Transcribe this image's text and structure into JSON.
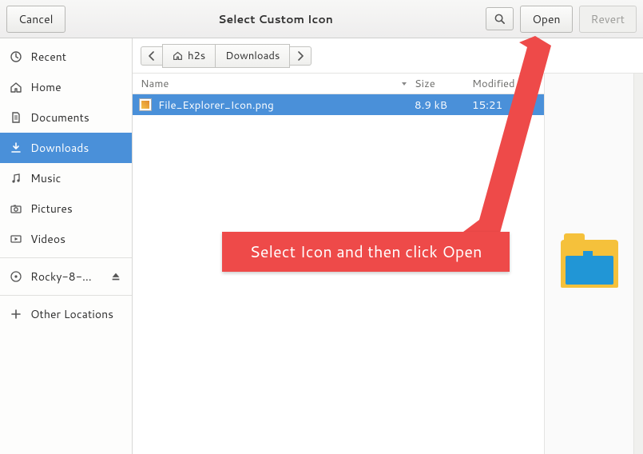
{
  "header": {
    "cancel": "Cancel",
    "title": "Select Custom Icon",
    "open": "Open",
    "revert": "Revert"
  },
  "sidebar": {
    "items": [
      {
        "icon": "clock",
        "label": "Recent"
      },
      {
        "icon": "home",
        "label": "Home"
      },
      {
        "icon": "doc",
        "label": "Documents"
      },
      {
        "icon": "download",
        "label": "Downloads",
        "selected": true
      },
      {
        "icon": "music",
        "label": "Music"
      },
      {
        "icon": "camera",
        "label": "Pictures"
      },
      {
        "icon": "video",
        "label": "Videos"
      }
    ],
    "volumes": [
      {
        "icon": "disc",
        "label": "Rocky-8-…",
        "eject": true
      }
    ],
    "other": {
      "icon": "plus",
      "label": "Other Locations"
    }
  },
  "path": {
    "segments": [
      {
        "icon": "chevron-left"
      },
      {
        "icon": "home",
        "label": "h2s"
      },
      {
        "label": "Downloads"
      },
      {
        "icon": "chevron-right"
      }
    ]
  },
  "columns": {
    "name": "Name",
    "size": "Size",
    "modified": "Modified"
  },
  "files": [
    {
      "name": "File_Explorer_Icon.png",
      "size": "8.9 kB",
      "modified": "15:21",
      "selected": true
    }
  ],
  "annotation": {
    "text": "Select Icon and then click Open"
  }
}
